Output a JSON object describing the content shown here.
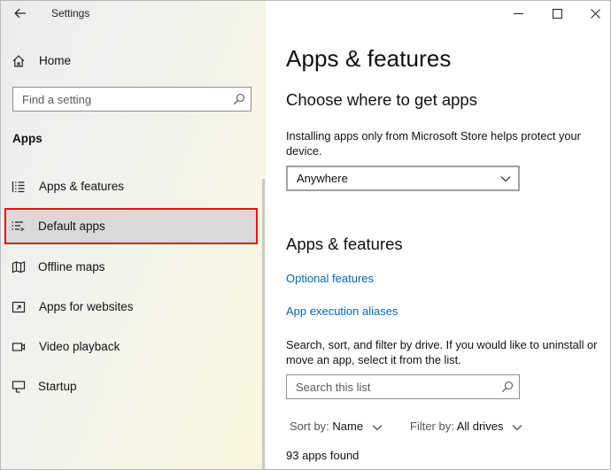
{
  "window": {
    "title": "Settings"
  },
  "sidebar": {
    "home_label": "Home",
    "search_placeholder": "Find a setting",
    "section_title": "Apps",
    "items": [
      {
        "label": "Apps & features",
        "icon": "apps-features-icon"
      },
      {
        "label": "Default apps",
        "icon": "default-apps-icon",
        "highlighted": true
      },
      {
        "label": "Offline maps",
        "icon": "offline-maps-icon"
      },
      {
        "label": "Apps for websites",
        "icon": "apps-for-websites-icon"
      },
      {
        "label": "Video playback",
        "icon": "video-playback-icon"
      },
      {
        "label": "Startup",
        "icon": "startup-icon"
      }
    ]
  },
  "main": {
    "page_title": "Apps & features",
    "choose_heading": "Choose where to get apps",
    "choose_description": "Installing apps only from Microsoft Store helps protect your device.",
    "source_dropdown_value": "Anywhere",
    "apps_heading": "Apps & features",
    "optional_features_link": "Optional features",
    "app_execution_aliases_link": "App execution aliases",
    "search_description": "Search, sort, and filter by drive. If you would like to uninstall or move an app, select it from the list.",
    "search_placeholder": "Search this list",
    "sort_label": "Sort by:",
    "sort_value": "Name",
    "filter_label": "Filter by:",
    "filter_value": "All drives",
    "apps_found": "93 apps found"
  },
  "colors": {
    "accent_link": "#0067c0",
    "highlight_border": "#e2141b",
    "selected_background": "#d9d9d9"
  }
}
